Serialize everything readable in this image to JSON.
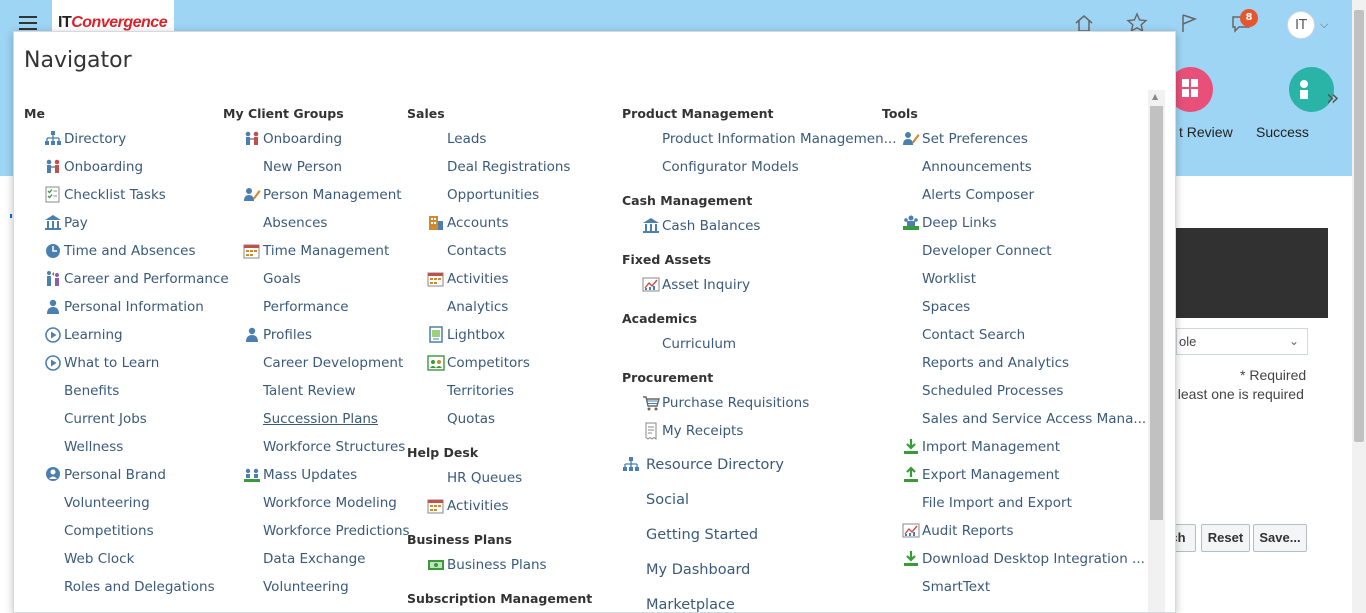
{
  "header": {
    "logo": {
      "part1": "IT",
      "part2": "Convergence"
    },
    "notification_count": "8",
    "user_initials": "IT",
    "icons": [
      "home-icon",
      "star-icon",
      "flag-icon",
      "notifications-icon"
    ]
  },
  "background": {
    "tiles": [
      {
        "label": "t Review",
        "color": "#e8507a"
      },
      {
        "label": "Success",
        "color": "#2ab3a7"
      }
    ],
    "select_value": "ole",
    "required_note": "* Required",
    "at_least_note": "t least one is required",
    "buttons": {
      "search": "ch",
      "reset": "Reset",
      "save": "Save..."
    }
  },
  "navigator": {
    "title": "Navigator",
    "groups": {
      "me": {
        "title": "Me",
        "items": [
          {
            "label": "Directory",
            "icon": "directory-icon"
          },
          {
            "label": "Onboarding",
            "icon": "onboarding-icon"
          },
          {
            "label": "Checklist Tasks",
            "icon": "checklist-icon"
          },
          {
            "label": "Pay",
            "icon": "bank-icon"
          },
          {
            "label": "Time and Absences",
            "icon": "clock-icon"
          },
          {
            "label": "Career and Performance",
            "icon": "career-icon"
          },
          {
            "label": "Personal Information",
            "icon": "person-icon"
          },
          {
            "label": "Learning",
            "icon": "play-icon"
          },
          {
            "label": "What to Learn",
            "icon": "play-icon"
          },
          {
            "label": "Benefits",
            "icon": ""
          },
          {
            "label": "Current Jobs",
            "icon": ""
          },
          {
            "label": "Wellness",
            "icon": ""
          },
          {
            "label": "Personal Brand",
            "icon": "brand-icon"
          },
          {
            "label": "Volunteering",
            "icon": ""
          },
          {
            "label": "Competitions",
            "icon": ""
          },
          {
            "label": "Web Clock",
            "icon": ""
          },
          {
            "label": "Roles and Delegations",
            "icon": ""
          }
        ]
      },
      "client": {
        "title": "My Client Groups",
        "items": [
          {
            "label": "Onboarding",
            "icon": "onboarding-icon"
          },
          {
            "label": "New Person",
            "icon": ""
          },
          {
            "label": "Person Management",
            "icon": "person-edit-icon"
          },
          {
            "label": "Absences",
            "icon": ""
          },
          {
            "label": "Time Management",
            "icon": "calendar-icon"
          },
          {
            "label": "Goals",
            "icon": ""
          },
          {
            "label": "Performance",
            "icon": ""
          },
          {
            "label": "Profiles",
            "icon": "person-icon"
          },
          {
            "label": "Career Development",
            "icon": ""
          },
          {
            "label": "Talent Review",
            "icon": ""
          },
          {
            "label": "Succession Plans",
            "icon": ""
          },
          {
            "label": "Workforce Structures",
            "icon": ""
          },
          {
            "label": "Mass Updates",
            "icon": "mass-update-icon"
          },
          {
            "label": "Workforce Modeling",
            "icon": ""
          },
          {
            "label": "Workforce Predictions",
            "icon": ""
          },
          {
            "label": "Data Exchange",
            "icon": ""
          },
          {
            "label": "Volunteering",
            "icon": ""
          }
        ]
      },
      "sales": {
        "title": "Sales",
        "items": [
          {
            "label": "Leads",
            "icon": ""
          },
          {
            "label": "Deal Registrations",
            "icon": ""
          },
          {
            "label": "Opportunities",
            "icon": ""
          },
          {
            "label": "Accounts",
            "icon": "building-icon"
          },
          {
            "label": "Contacts",
            "icon": ""
          },
          {
            "label": "Activities",
            "icon": "calendar-icon"
          },
          {
            "label": "Analytics",
            "icon": ""
          },
          {
            "label": "Lightbox",
            "icon": "lightbox-icon"
          },
          {
            "label": "Competitors",
            "icon": "competitors-icon"
          },
          {
            "label": "Territories",
            "icon": ""
          },
          {
            "label": "Quotas",
            "icon": ""
          }
        ]
      },
      "helpdesk": {
        "title": "Help Desk",
        "items": [
          {
            "label": "HR Queues",
            "icon": ""
          },
          {
            "label": "Activities",
            "icon": "calendar-icon"
          }
        ]
      },
      "bizplans": {
        "title": "Business Plans",
        "items": [
          {
            "label": "Business Plans",
            "icon": "money-icon"
          }
        ]
      },
      "subscription": {
        "title": "Subscription Management"
      },
      "product": {
        "title": "Product Management",
        "items": [
          {
            "label": "Product Information Managemen...",
            "icon": ""
          },
          {
            "label": "Configurator Models",
            "icon": ""
          }
        ]
      },
      "cash": {
        "title": "Cash Management",
        "items": [
          {
            "label": "Cash Balances",
            "icon": "bank-icon"
          }
        ]
      },
      "fixed": {
        "title": "Fixed Assets",
        "items": [
          {
            "label": "Asset Inquiry",
            "icon": "chart-icon"
          }
        ]
      },
      "academics": {
        "title": "Academics",
        "items": [
          {
            "label": "Curriculum",
            "icon": ""
          }
        ]
      },
      "procurement": {
        "title": "Procurement",
        "items": [
          {
            "label": "Purchase Requisitions",
            "icon": "cart-icon"
          },
          {
            "label": "My Receipts",
            "icon": "receipt-icon"
          }
        ]
      },
      "standalone": [
        {
          "label": "Resource Directory",
          "icon": "directory-icon"
        },
        {
          "label": "Social",
          "icon": ""
        },
        {
          "label": "Getting Started",
          "icon": ""
        },
        {
          "label": "My Dashboard",
          "icon": ""
        },
        {
          "label": "Marketplace",
          "icon": ""
        }
      ],
      "tools": {
        "title": "Tools",
        "items": [
          {
            "label": "Set Preferences",
            "icon": "person-edit-icon"
          },
          {
            "label": "Announcements",
            "icon": ""
          },
          {
            "label": "Alerts Composer",
            "icon": ""
          },
          {
            "label": "Deep Links",
            "icon": "deep-links-icon"
          },
          {
            "label": "Developer Connect",
            "icon": ""
          },
          {
            "label": "Worklist",
            "icon": ""
          },
          {
            "label": "Spaces",
            "icon": ""
          },
          {
            "label": "Contact Search",
            "icon": ""
          },
          {
            "label": "Reports and Analytics",
            "icon": ""
          },
          {
            "label": "Scheduled Processes",
            "icon": ""
          },
          {
            "label": "Sales and Service Access Mana...",
            "icon": ""
          },
          {
            "label": "Import Management",
            "icon": "download-icon"
          },
          {
            "label": "Export Management",
            "icon": "upload-icon"
          },
          {
            "label": "File Import and Export",
            "icon": ""
          },
          {
            "label": "Audit Reports",
            "icon": "chart-icon"
          },
          {
            "label": "Download Desktop Integration ...",
            "icon": "download-icon"
          },
          {
            "label": "SmartText",
            "icon": ""
          }
        ]
      }
    }
  },
  "colors": {
    "header_bg": "#9ed4f4",
    "link": "#3a5a7a",
    "icon_blue": "#4a7fb0",
    "icon_green": "#3a9a3a",
    "badge": "#e8542e"
  }
}
